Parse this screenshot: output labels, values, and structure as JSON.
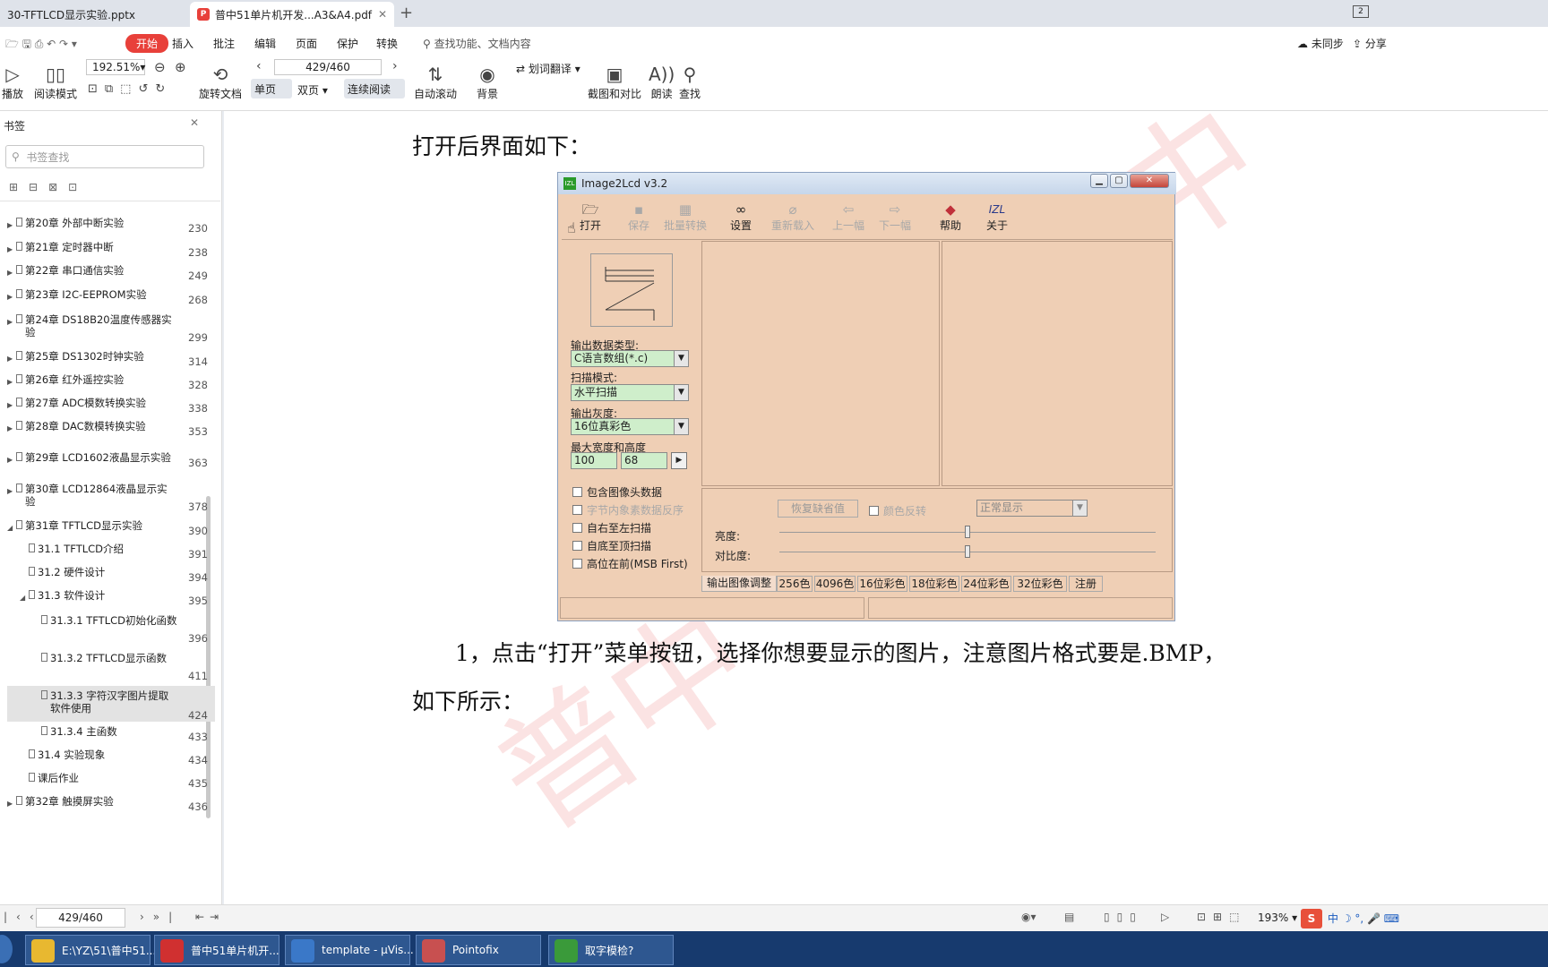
{
  "tabs": [
    {
      "label": "30-TFTLCD显示实验.pptx"
    },
    {
      "label": "普中51单片机开发...A3&A4.pdf"
    }
  ],
  "tab_badge": "2",
  "menu": {
    "items": [
      "开始",
      "插入",
      "批注",
      "编辑",
      "页面",
      "保护",
      "转换"
    ],
    "search": "查找功能、文档内容",
    "sync": "未同步",
    "share": "分享"
  },
  "toolbar": {
    "play": "播放",
    "read_mode": "阅读模式",
    "zoom": "192.51%",
    "rotate": "旋转文档",
    "page": "429/460",
    "single": "单页",
    "double": "双页",
    "continuous": "连续阅读",
    "auto_scroll": "自动滚动",
    "translate": "划词翻译",
    "background": "背景",
    "screenshot": "截图和对比",
    "read_aloud": "朗读",
    "find": "查找"
  },
  "sidebar": {
    "title": "书签",
    "search_placeholder": "书签查找",
    "items": [
      {
        "label": "第20章 外部中断实验",
        "page": "230"
      },
      {
        "label": "第21章 定时器中断",
        "page": "238"
      },
      {
        "label": "第22章 串口通信实验",
        "page": "249"
      },
      {
        "label": "第23章 I2C-EEPROM实验",
        "page": "268"
      },
      {
        "label": "第24章 DS18B20温度传感器实验",
        "page": "299"
      },
      {
        "label": "第25章 DS1302时钟实验",
        "page": "314"
      },
      {
        "label": "第26章 红外遥控实验",
        "page": "328"
      },
      {
        "label": "第27章 ADC模数转换实验",
        "page": "338"
      },
      {
        "label": "第28章 DAC数模转换实验",
        "page": "353"
      },
      {
        "label": "第29章 LCD1602液晶显示实验",
        "page": "363"
      },
      {
        "label": "第30章 LCD12864液晶显示实验",
        "page": "378"
      },
      {
        "label": "第31章 TFTLCD显示实验",
        "page": "390"
      },
      {
        "label": "31.1 TFTLCD介绍",
        "page": "391"
      },
      {
        "label": "31.2 硬件设计",
        "page": "394"
      },
      {
        "label": "31.3 软件设计",
        "page": "395"
      },
      {
        "label": "31.3.1 TFTLCD初始化函数",
        "page": "396"
      },
      {
        "label": "31.3.2 TFTLCD显示函数",
        "page": "411"
      },
      {
        "label": "31.3.3 字符汉字图片提取软件使用",
        "page": "424"
      },
      {
        "label": "31.3.4 主函数",
        "page": "433"
      },
      {
        "label": "31.4 实验现象",
        "page": "434"
      },
      {
        "label": "课后作业",
        "page": "435"
      },
      {
        "label": "第32章 触摸屏实验",
        "page": "436"
      }
    ]
  },
  "doc": {
    "p1": "打开后界面如下：",
    "p2": "1，点击“打开”菜单按钮，选择你想要显示的图片，注意图片格式要是.BMP，",
    "p3": "如下所示：",
    "watermark": "普中"
  },
  "img2lcd": {
    "title": "Image2Lcd v3.2",
    "toolbar": [
      "打开",
      "保存",
      "批量转换",
      "设置",
      "重新载入",
      "上一幅",
      "下一幅",
      "帮助",
      "关于"
    ],
    "out_type_label": "输出数据类型:",
    "out_type": "C语言数组(*.c)",
    "scan_label": "扫描模式:",
    "scan": "水平扫描",
    "gray_label": "输出灰度:",
    "gray": "16位真彩色",
    "size_label": "最大宽度和高度",
    "width": "100",
    "height": "68",
    "checks": [
      "包含图像头数据",
      "字节内象素数据反序",
      "自右至左扫描",
      "自底至顶扫描",
      "高位在前(MSB First)"
    ],
    "restore": "恢复缺省值",
    "invert": "颜色反转",
    "display": "正常显示",
    "brightness": "亮度:",
    "contrast": "对比度:",
    "brightness_value": 0.5,
    "contrast_value": 0.5,
    "tabs": [
      "输出图像调整",
      "256色",
      "4096色",
      "16位彩色",
      "18位彩色",
      "24位彩色",
      "32位彩色",
      "注册"
    ]
  },
  "statusbar": {
    "page": "429/460",
    "zoom": "193%"
  },
  "taskbar": [
    {
      "label": "E:\\YZ\\51\\普中51...",
      "color": "#e8b830"
    },
    {
      "label": "普中51单片机开...",
      "color": "#d03030"
    },
    {
      "label": "template  - µVis...",
      "color": "#3a78c8"
    },
    {
      "label": "Pointofix",
      "color": "#c85050"
    },
    {
      "label": "取字模检?",
      "color": "#3a9a3a"
    }
  ],
  "tray": {
    "ime": "中"
  }
}
